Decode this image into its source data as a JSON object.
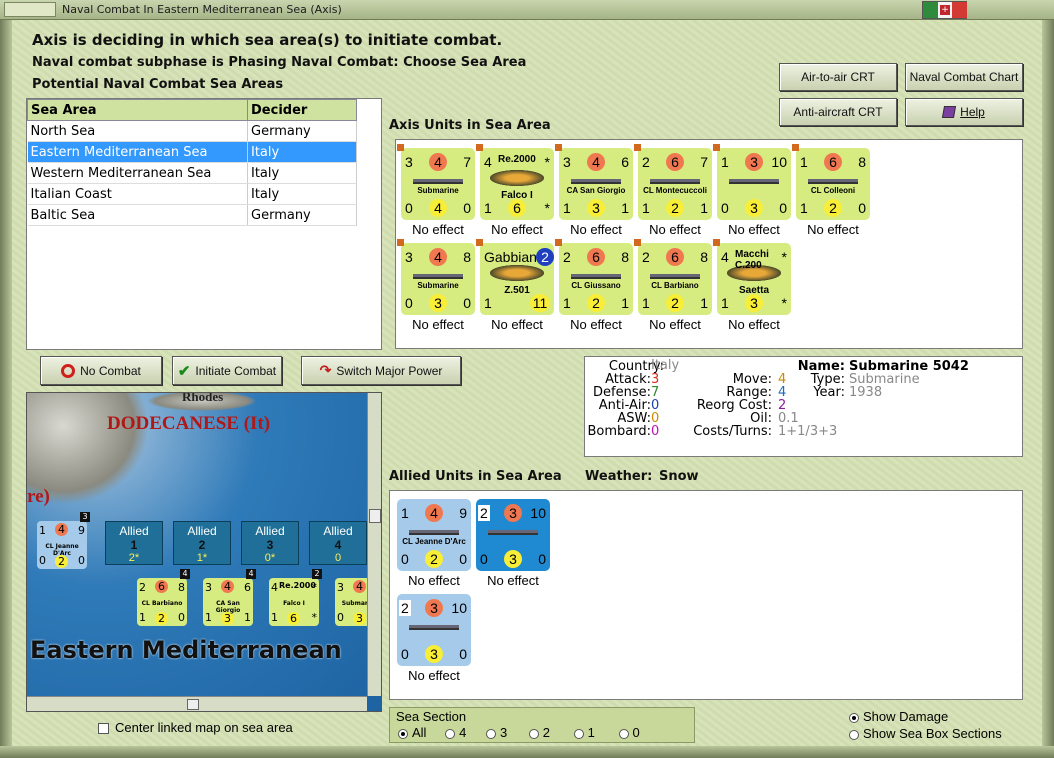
{
  "window": {
    "title": "Naval Combat In Eastern Mediterranean Sea (Axis)"
  },
  "header": {
    "line1": "Axis is deciding in which sea area(s) to initiate combat.",
    "line2": "Naval combat subphase is Phasing Naval Combat: Choose Sea Area",
    "line3": "Potential Naval Combat Sea Areas"
  },
  "top_buttons": {
    "air_to_air": "Air-to-air CRT",
    "naval_chart": "Naval Combat Chart",
    "anti_aircraft": "Anti-aircraft CRT",
    "help": "Help"
  },
  "sea_table": {
    "headers": [
      "Sea Area",
      "Decider"
    ],
    "rows": [
      [
        "North Sea",
        "Germany"
      ],
      [
        "Eastern Mediterranean Sea",
        "Italy"
      ],
      [
        "Western Mediterranean Sea",
        "Italy"
      ],
      [
        "Italian Coast",
        "Italy"
      ],
      [
        "Baltic Sea",
        "Germany"
      ]
    ],
    "selected": "Eastern Mediterranean Sea"
  },
  "axis_units": {
    "title": "Axis Units in Sea Area",
    "cards": [
      {
        "tl": "3",
        "tc": "4",
        "tr": "7",
        "label": "Submarine",
        "bl": "0",
        "bc": "4",
        "br": "0",
        "effect": "No effect",
        "kind": "ship",
        "style": "y"
      },
      {
        "tl": "4",
        "tc": "Re.2000",
        "tr": "*",
        "label": "Falco I",
        "bl": "1",
        "bc": "6",
        "br": "*",
        "effect": "No effect",
        "kind": "plane",
        "style": "y"
      },
      {
        "tl": "3",
        "tc": "4",
        "tr": "6",
        "label": "CA San Giorgio",
        "bl": "1",
        "bc": "3",
        "br": "1",
        "effect": "No effect",
        "kind": "ship",
        "style": "y"
      },
      {
        "tl": "2",
        "tc": "6",
        "tr": "7",
        "label": "CL Montecuccoli",
        "bl": "1",
        "bc": "2",
        "br": "1",
        "effect": "No effect",
        "kind": "ship",
        "style": "y"
      },
      {
        "tl": "1",
        "tc": "3",
        "tr": "10",
        "label": "",
        "bl": "0",
        "bc": "3",
        "br": "0",
        "effect": "No effect",
        "kind": "ship",
        "style": "y"
      },
      {
        "tl": "1",
        "tc": "6",
        "tr": "8",
        "label": "CL Colleoni",
        "bl": "1",
        "bc": "2",
        "br": "0",
        "effect": "No effect",
        "kind": "ship",
        "style": "y"
      },
      {
        "tl": "3",
        "tc": "4",
        "tr": "8",
        "label": "Submarine",
        "bl": "0",
        "bc": "3",
        "br": "0",
        "effect": "No effect",
        "kind": "ship",
        "style": "y"
      },
      {
        "tl": "Gabbiano",
        "tc": "2",
        "tr": "",
        "label": "Z.501",
        "bl": "1",
        "bc": "11",
        "br": "",
        "effect": "No effect",
        "kind": "plane",
        "style": "y"
      },
      {
        "tl": "2",
        "tc": "6",
        "tr": "8",
        "label": "CL Giussano",
        "bl": "1",
        "bc": "2",
        "br": "1",
        "effect": "No effect",
        "kind": "ship",
        "style": "y"
      },
      {
        "tl": "2",
        "tc": "6",
        "tr": "8",
        "label": "CL Barbiano",
        "bl": "1",
        "bc": "2",
        "br": "1",
        "effect": "No effect",
        "kind": "ship",
        "style": "y"
      },
      {
        "tl": "4",
        "tc": "Macchi C.200",
        "tr": "*",
        "label": "Saetta",
        "bl": "1",
        "bc": "3",
        "br": "*",
        "effect": "No effect",
        "kind": "plane",
        "style": "y"
      }
    ]
  },
  "action_buttons": {
    "no_combat": "No Combat",
    "initiate": "Initiate Combat",
    "switch": "Switch Major Power"
  },
  "unit_info": {
    "country_k": "Country:",
    "country_v": "Italy",
    "attack_k": "Attack:",
    "attack_v": "3",
    "defense_k": "Defense:",
    "defense_v": "7",
    "antiair_k": "Anti-Air:",
    "antiair_v": "0",
    "asw_k": "ASW:",
    "asw_v": "0",
    "bombard_k": "Bombard:",
    "bombard_v": "0",
    "move_k": "Move:",
    "move_v": "4",
    "range_k": "Range:",
    "range_v": "4",
    "reorg_k": "Reorg Cost:",
    "reorg_v": "2",
    "oil_k": "Oil:",
    "oil_v": "0.1",
    "costs_k": "Costs/Turns:",
    "costs_v": "1+1/3+3",
    "name_k": "Name:",
    "name_v": "Submarine 5042",
    "type_k": "Type:",
    "type_v": "Submarine",
    "year_k": "Year:",
    "year_v": "1938"
  },
  "allied_units": {
    "title": "Allied Units in Sea Area",
    "weather_k": "Weather:",
    "weather_v": "Snow",
    "cards": [
      {
        "tl": "1",
        "tc": "4",
        "tr": "9",
        "label": "CL Jeanne D'Arc",
        "bl": "0",
        "bc": "2",
        "br": "0",
        "effect": "No effect",
        "style": "b"
      },
      {
        "tl": "2",
        "tc": "3",
        "tr": "10",
        "label": "",
        "bl": "0",
        "bc": "3",
        "br": "0",
        "effect": "No effect",
        "style": "bd"
      },
      {
        "tl": "2",
        "tc": "3",
        "tr": "10",
        "label": "",
        "bl": "0",
        "bc": "3",
        "br": "0",
        "effect": "No effect",
        "style": "b"
      }
    ]
  },
  "map": {
    "region": "DODECANESE (It)",
    "region2": "re)",
    "sea_label": "Eastern Mediterranean",
    "rhodes": "Rhodes",
    "allied_boxes": [
      {
        "t": "Allied",
        "n": "1",
        "s": "2*"
      },
      {
        "t": "Allied",
        "n": "2",
        "s": "1*"
      },
      {
        "t": "Allied",
        "n": "3",
        "s": "0*"
      },
      {
        "t": "Allied",
        "n": "4",
        "s": "0"
      }
    ],
    "mini": [
      {
        "tl": "1",
        "tc": "4",
        "tr": "9",
        "label": "CL Jeanne D'Arc",
        "bl": "0",
        "bc": "2",
        "br": "0",
        "badge": "3"
      },
      {
        "tl": "2",
        "tc": "6",
        "tr": "8",
        "label": "CL Barbiano",
        "bl": "1",
        "bc": "2",
        "br": "0",
        "badge": "4"
      },
      {
        "tl": "3",
        "tc": "4",
        "tr": "6",
        "label": "CA San Giorgio",
        "bl": "1",
        "bc": "3",
        "br": "1",
        "badge": "4"
      },
      {
        "tl": "4",
        "tc": "Re.2000",
        "tr": "*",
        "label": "Falco I",
        "bl": "1",
        "bc": "6",
        "br": "*",
        "badge": "2"
      },
      {
        "tl": "3",
        "tc": "4",
        "tr": "8",
        "label": "Submarine",
        "bl": "0",
        "bc": "3",
        "br": "0",
        "badge": "2"
      }
    ],
    "center_label": "Center linked map on sea area"
  },
  "sea_section": {
    "title": "Sea Section",
    "options": [
      "All",
      "4",
      "3",
      "2",
      "1",
      "0"
    ],
    "selected": "All"
  },
  "display": {
    "show_damage": "Show Damage",
    "show_box": "Show Sea Box Sections",
    "selected": "Show Damage"
  },
  "colors": {
    "attack": "#d9301a",
    "defense": "#2a8a2a",
    "antiair": "#1a3fb0",
    "asw": "#d08a00",
    "bombard": "#c010c0",
    "move": "#c98a00",
    "range": "#1a6ac0",
    "reorg": "#8a1aa0",
    "selected_row": "#3399ff"
  }
}
